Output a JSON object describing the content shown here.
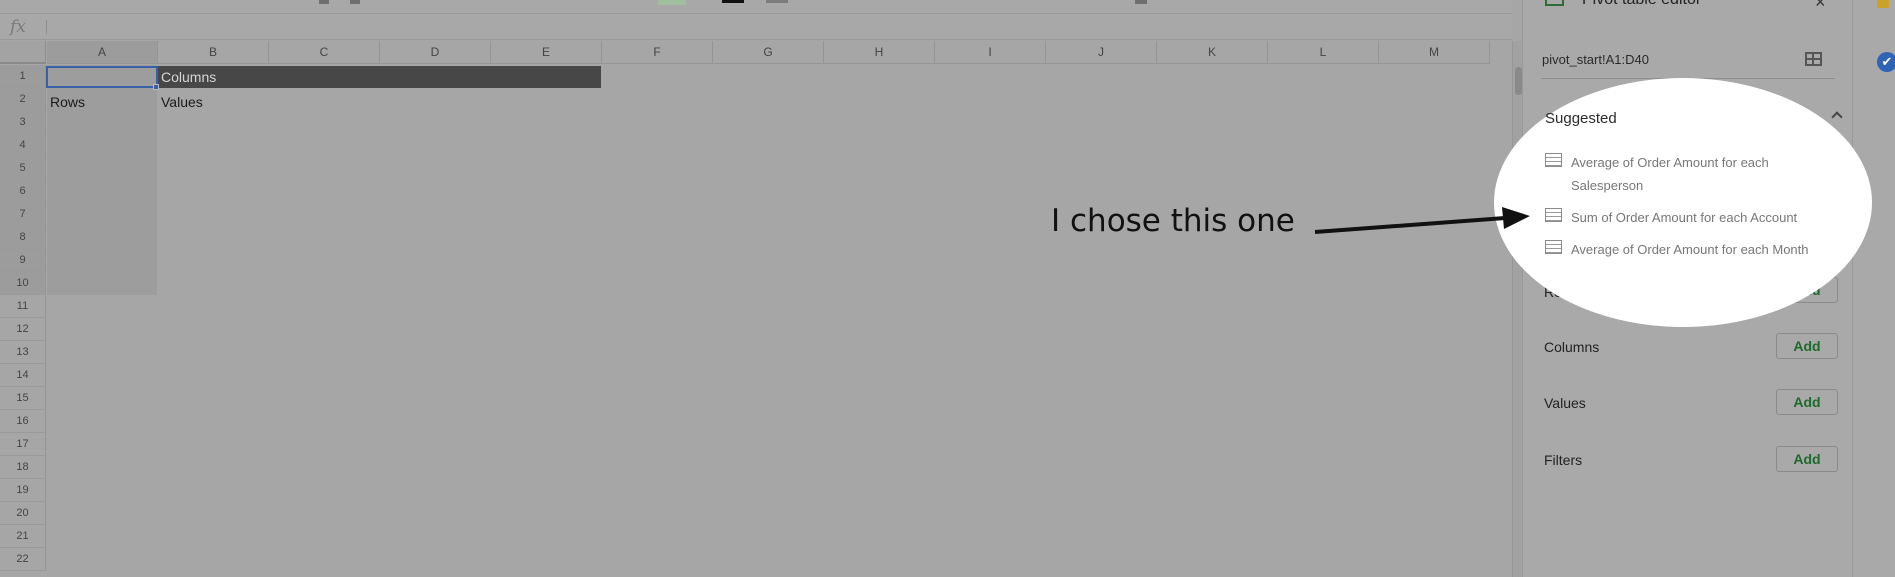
{
  "formula_bar": {
    "fx_symbol": "fx"
  },
  "columns": [
    "A",
    "B",
    "C",
    "D",
    "E",
    "F",
    "G",
    "H",
    "I",
    "J",
    "K",
    "L",
    "M"
  ],
  "rows": [
    "1",
    "2",
    "3",
    "4",
    "5",
    "6",
    "7",
    "8",
    "9",
    "10",
    "11",
    "12",
    "13",
    "14",
    "15",
    "16",
    "17",
    "18",
    "19",
    "20",
    "21",
    "22"
  ],
  "cells": {
    "B1": "Columns",
    "A2": "Rows",
    "B2": "Values"
  },
  "pivot_panel": {
    "title": "Pivot table editor",
    "close_icon": "×",
    "range": "pivot_start!A1:D40",
    "suggested_label": "Suggested",
    "suggestions": [
      "Average of Order Amount for each Salesperson",
      "Sum of Order Amount for each Account",
      "Average of Order Amount for each Month"
    ],
    "sections": [
      {
        "label": "Rows",
        "button": "Add"
      },
      {
        "label": "Columns",
        "button": "Add"
      },
      {
        "label": "Values",
        "button": "Add"
      },
      {
        "label": "Filters",
        "button": "Add"
      }
    ]
  },
  "rail": {
    "check_icon": "✔"
  },
  "annotation": {
    "text": "I chose this one"
  },
  "colors": {
    "accent_green": "#1e6a2a",
    "selection_blue": "#3a5fa6",
    "highlight": "#ffffff"
  }
}
